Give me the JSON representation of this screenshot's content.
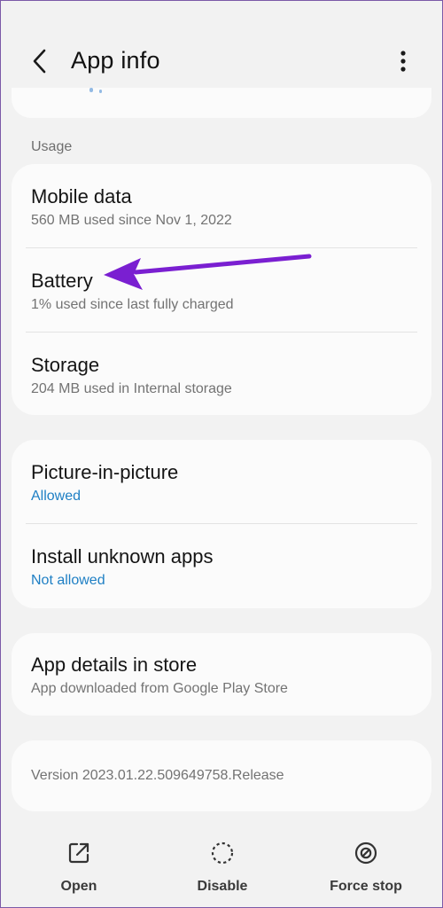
{
  "header": {
    "title": "App info",
    "back_icon": "chevron-left-icon",
    "menu_icon": "more-vertical-icon"
  },
  "usage": {
    "section_label": "Usage",
    "items": [
      {
        "title": "Mobile data",
        "subtitle": "560 MB used since Nov 1, 2022"
      },
      {
        "title": "Battery",
        "subtitle": "1% used since last fully charged"
      },
      {
        "title": "Storage",
        "subtitle": "204 MB used in Internal storage"
      }
    ]
  },
  "permissions": {
    "items": [
      {
        "title": "Picture-in-picture",
        "subtitle": "Allowed"
      },
      {
        "title": "Install unknown apps",
        "subtitle": "Not allowed"
      }
    ]
  },
  "store": {
    "title": "App details in store",
    "subtitle": "App downloaded from Google Play Store"
  },
  "version": {
    "text": "Version 2023.01.22.509649758.Release"
  },
  "bottom_bar": {
    "open_label": "Open",
    "disable_label": "Disable",
    "force_stop_label": "Force stop"
  },
  "colors": {
    "accent_blue": "#1e7fc4",
    "annotation_arrow": "#7a1fd1",
    "background": "#f2f2f2",
    "card": "#fbfbfb"
  }
}
